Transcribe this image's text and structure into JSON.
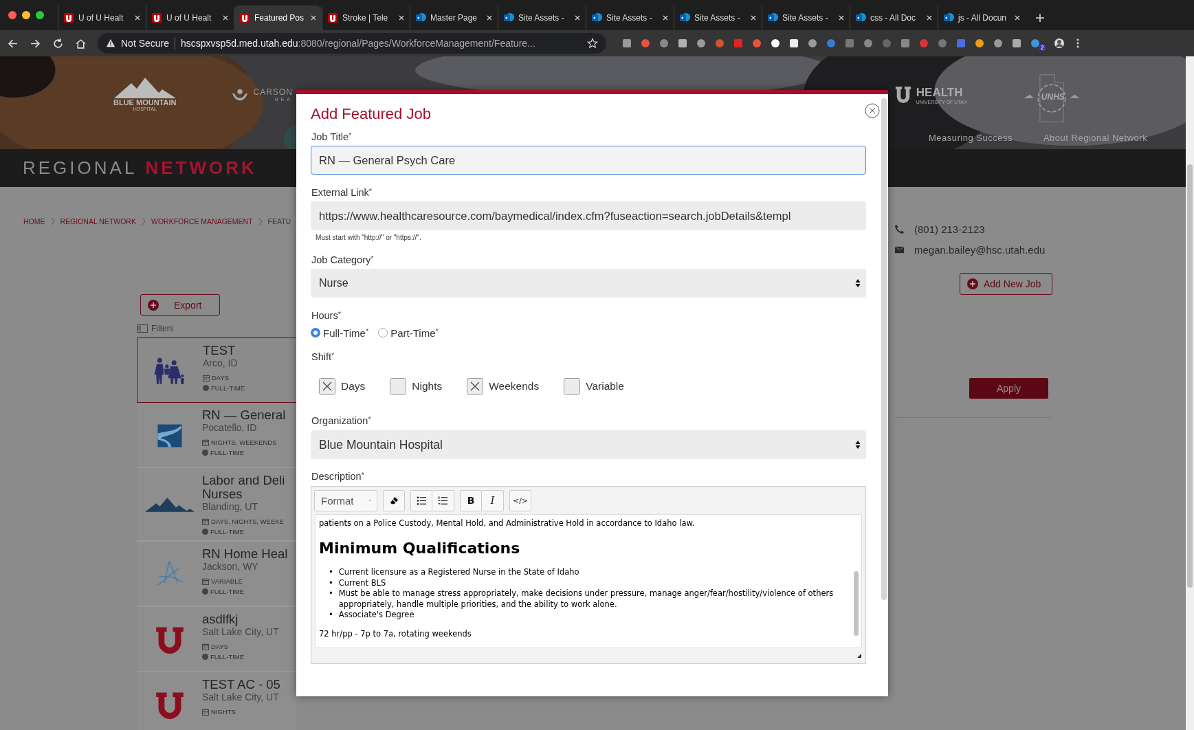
{
  "browser": {
    "tabs": [
      {
        "title": "U of U Healt",
        "kind": "uofu",
        "selected": false
      },
      {
        "title": "U of U Healt",
        "kind": "uofu",
        "selected": false
      },
      {
        "title": "Featured Pos",
        "kind": "uofu",
        "selected": true
      },
      {
        "title": "Stroke | Tele",
        "kind": "uofu",
        "selected": false
      },
      {
        "title": "Master Page",
        "kind": "sharepoint",
        "selected": false
      },
      {
        "title": "Site Assets -",
        "kind": "sharepoint",
        "selected": false
      },
      {
        "title": "Site Assets -",
        "kind": "sharepoint",
        "selected": false
      },
      {
        "title": "Site Assets -",
        "kind": "sharepoint",
        "selected": false
      },
      {
        "title": "Site Assets -",
        "kind": "sharepoint",
        "selected": false
      },
      {
        "title": "css - All Doc",
        "kind": "sharepoint",
        "selected": false
      },
      {
        "title": "js - All Docun",
        "kind": "sharepoint",
        "selected": false
      }
    ],
    "security": "Not Secure",
    "url_host": "hscspxvsp5d.med.utah.edu",
    "url_path": ":8080/regional/Pages/WorkforceManagement/Feature...",
    "badge": "2"
  },
  "banner": {
    "logos": [
      {
        "kind": "mountain",
        "lines": [
          "BLUE MOUNTAIN",
          "HOSPITAL"
        ]
      },
      {
        "kind": "hands",
        "lines": [
          "CARSON",
          "HEA"
        ]
      },
      {
        "kind": "u",
        "lines": [
          "HEALTH",
          "UNIVERSITY OF UTAH"
        ]
      },
      {
        "kind": "state",
        "lines": [
          "UNHS"
        ]
      }
    ],
    "nav": [
      "Measuring Success",
      "About Regional Network"
    ]
  },
  "section_bar": {
    "title": "REGIONAL",
    "highlight": "NETWORK"
  },
  "breadcrumb": [
    "HOME",
    "REGIONAL NETWORK",
    "WORKFORCE MANAGEMENT",
    "FEATU"
  ],
  "export_button": "Export",
  "filters": "Filters",
  "jobs": [
    {
      "title": "TEST",
      "location": "Arco, ID",
      "shifts": "DAYS",
      "hours": "FULL-TIME",
      "kind": "family",
      "selected": true
    },
    {
      "title": "RN — General",
      "location": "Pocatello, ID",
      "shifts": "NIGHTS, WEEKENDS",
      "hours": "FULL-TIME",
      "kind": "road",
      "selected": false
    },
    {
      "title": "Labor and Deli\nNurses",
      "location": "Blanding, UT",
      "shifts": "DAYS, NIGHTS, WEEKE",
      "hours": "FULL-TIME",
      "kind": "mountain",
      "selected": false
    },
    {
      "title": "RN Home Heal",
      "location": "Jackson, WY",
      "shifts": "VARIABLE",
      "hours": "FULL-TIME",
      "kind": "strokes",
      "selected": false
    },
    {
      "title": "asdlfkj",
      "location": "Salt Lake City, UT",
      "shifts": "DAYS",
      "hours": "FULL-TIME",
      "kind": "u",
      "selected": false
    },
    {
      "title": "TEST AC - 05",
      "location": "Salt Lake City, UT",
      "shifts": "NIGHTS",
      "kind": "u",
      "selected": false
    }
  ],
  "contact": {
    "phone": "(801) 213-2123",
    "email": "megan.bailey@hsc.utah.edu"
  },
  "add_job_button": "Add New Job",
  "apply_button": "Apply",
  "modal": {
    "title": "Add Featured Job",
    "job_title": {
      "label": "Job Title",
      "mark": "*",
      "value": "RN — General Psych Care",
      "focused": true
    },
    "external_link": {
      "label": "External Link",
      "mark": "*",
      "value": "https://www.healthcaresource.com/baymedical/index.cfm?fuseaction=search.jobDetails&templ",
      "hint": "Must start with \"http://\" or \"https://\"."
    },
    "job_category": {
      "label": "Job Category",
      "mark": "*",
      "value": "Nurse"
    },
    "hours": {
      "label": "Hours",
      "mark": "*",
      "options": [
        {
          "label": "Full-Time",
          "mark": "*",
          "selected": true
        },
        {
          "label": "Part-Time",
          "mark": "*",
          "selected": false
        }
      ]
    },
    "shift": {
      "label": "Shift",
      "mark": "*",
      "options": [
        {
          "label": "Days",
          "checked": true
        },
        {
          "label": "Nights",
          "checked": false
        },
        {
          "label": "Weekends",
          "checked": true
        },
        {
          "label": "Variable",
          "checked": false
        }
      ]
    },
    "organization": {
      "label": "Organization",
      "mark": "*",
      "value": "Blue Mountain Hospital"
    },
    "description": {
      "label": "Description",
      "mark": "*",
      "format": "Format",
      "bold": "B",
      "italic": "I",
      "code": "</>",
      "blocks": [
        {
          "kind": "p",
          "text": "patients on a Police Custody, Mental Hold, and Administrative Hold in accordance to Idaho law."
        },
        {
          "kind": "h",
          "text": "Minimum Qualifications"
        },
        {
          "kind": "ul",
          "bullet": "•",
          "items": [
            "Current licensure as a Registered Nurse in the State of Idaho",
            "Current BLS",
            "Must be able to manage stress appropriately, make decisions under pressure, manage anger/fear/hostility/violence of others appropriately, handle multiple priorities, and the ability to work alone.",
            "Associate's Degree"
          ]
        },
        {
          "kind": "p",
          "text": "72 hr/pp - 7p to 7a, rotating weekends"
        }
      ]
    }
  }
}
